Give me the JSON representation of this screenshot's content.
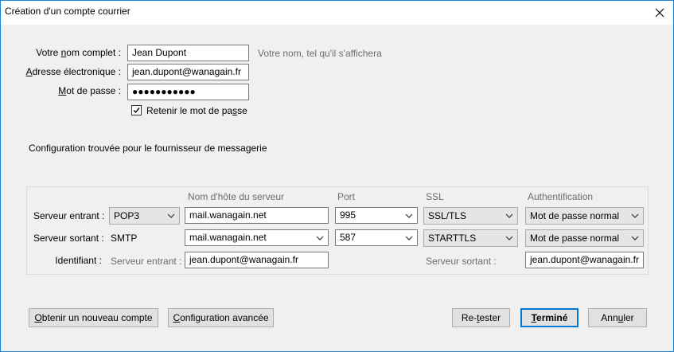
{
  "window": {
    "title": "Création d'un compte courrier",
    "close_icon": "close-icon"
  },
  "account": {
    "name_label_pre": "Votre ",
    "name_label_key": "n",
    "name_label_post": "om complet :",
    "name_value": "Jean Dupont",
    "name_hint": "Votre nom, tel qu'il s'affichera",
    "email_label_key": "A",
    "email_label_post": "dresse électronique :",
    "email_value": "jean.dupont@wanagain.fr",
    "password_label_key": "M",
    "password_label_post": "ot de passe :",
    "password_value": "●●●●●●●●●●●",
    "remember_pre": "Retenir le mot de pa",
    "remember_key": "s",
    "remember_post": "se",
    "remember_checked": true
  },
  "config_found": "Configuration trouvée pour le fournisseur de messagerie",
  "servers": {
    "headers": {
      "hostname": "Nom d'hôte du serveur",
      "port": "Port",
      "ssl": "SSL",
      "auth": "Authentification"
    },
    "incoming": {
      "label": "Serveur entrant :",
      "protocol": "POP3",
      "hostname": "mail.wanagain.net",
      "port": "995",
      "ssl": "SSL/TLS",
      "auth": "Mot de passe normal"
    },
    "outgoing": {
      "label": "Serveur sortant :",
      "protocol": "SMTP",
      "hostname": "mail.wanagain.net",
      "port": "587",
      "ssl": "STARTTLS",
      "auth": "Mot de passe normal"
    },
    "identity": {
      "label": "Identifiant :",
      "incoming_label": "Serveur entrant :",
      "incoming_value": "jean.dupont@wanagain.fr",
      "outgoing_label": "Serveur sortant :",
      "outgoing_value": "jean.dupont@wanagain.fr"
    }
  },
  "buttons": {
    "new_account_key": "O",
    "new_account_post": "btenir un nouveau compte",
    "advanced_key": "C",
    "advanced_post": "onfiguration avancée",
    "retest_pre": "Re-",
    "retest_key": "t",
    "retest_post": "ester",
    "done_key": "T",
    "done_post": "erminé",
    "cancel_pre": "Ann",
    "cancel_key": "u",
    "cancel_post": "ler"
  }
}
